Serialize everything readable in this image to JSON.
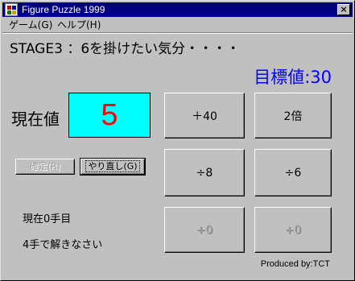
{
  "window": {
    "title": "Figure Puzzle 1999",
    "close_label": "×"
  },
  "menu": {
    "items": [
      {
        "label": "ゲーム(G)"
      },
      {
        "label": "ヘルプ(H)"
      }
    ]
  },
  "stage_title": "STAGE3 ：6を掛けたい気分・・・・",
  "target": "目標値:30",
  "current": {
    "label": "現在値",
    "value": "5"
  },
  "operations": [
    {
      "label": "＋40",
      "enabled": true
    },
    {
      "label": "2倍",
      "enabled": true
    },
    {
      "label": "÷8",
      "enabled": true
    },
    {
      "label": "÷6",
      "enabled": true
    },
    {
      "label": "+0",
      "enabled": false
    },
    {
      "label": "+0",
      "enabled": false
    }
  ],
  "controls": {
    "confirm_label": "確定(R)",
    "redo_label": "やり直し(G)"
  },
  "status": {
    "moves": "現在0手目",
    "instruction": "4手で解きなさい"
  },
  "footer": "Produced by:TCT"
}
